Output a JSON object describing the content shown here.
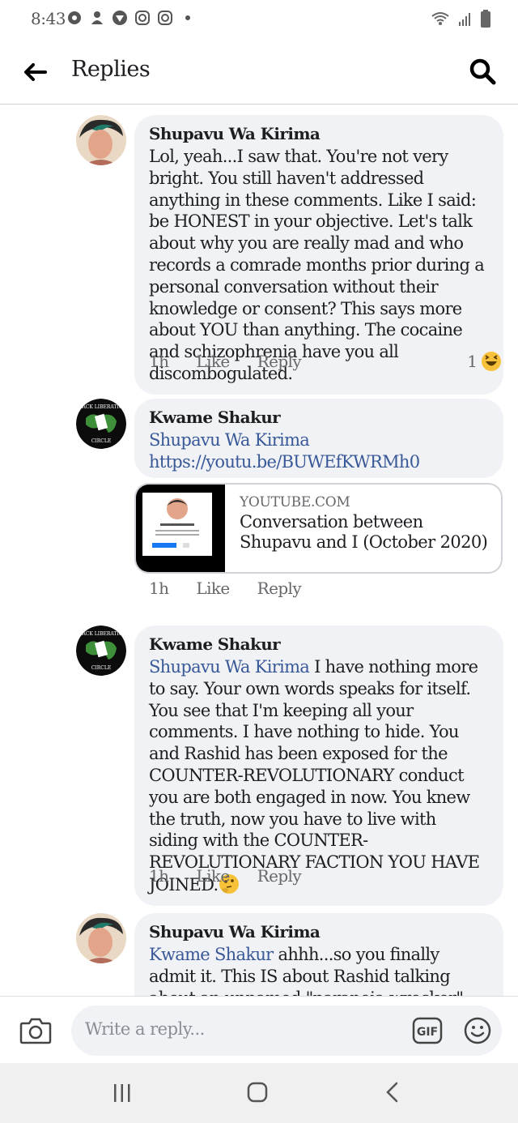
{
  "status_bar": {
    "time": "8:43"
  },
  "header": {
    "back_icon": "arrow-left-icon",
    "title": "Replies",
    "search_icon": "search-icon"
  },
  "comments": [
    {
      "author": "Shupavu Wa Kirima",
      "text": "Lol, yeah...I saw that. You're not very bright. You still haven't addressed anything in these comments. Like I said: be HONEST in your objective. Let's talk about why you are really mad and who records a comrade months prior during a personal conversation without their knowledge or consent? This says more about YOU than anything. The cocaine and schizophrenia have you all discombogulated.",
      "time": "1h",
      "like": "Like",
      "reply": "Reply",
      "reaction_count": "1",
      "reaction_icon": "haha-emoji-icon"
    },
    {
      "author": "Kwame Shakur",
      "mention": "Shupavu Wa Kirima",
      "link": "https://youtu.be/BUWEfKWRMh0",
      "card": {
        "domain": "YOUTUBE.COM",
        "title": "Conversation between Shupavu and I (October 2020)"
      },
      "time": "1h",
      "like": "Like",
      "reply": "Reply"
    },
    {
      "author": "Kwame Shakur",
      "mention": "Shupavu Wa Kirima",
      "text": " I have nothing more to say. Your own words speaks for itself. You see that I'm keeping all your comments. I have nothing to hide. You and Rashid has been exposed for the COUNTER-REVOLUTIONARY conduct you are both engaged in now. You knew the truth, now you have to live with siding with the COUNTER-REVOLUTIONARY FACTION YOU HAVE JOINED.",
      "emoji_icon": "thinking-emoji-icon",
      "time": "1h",
      "like": "Like",
      "reply": "Reply"
    },
    {
      "author": "Shupavu Wa Kirima",
      "mention": "Kwame Shakur",
      "text": " ahhh...so you finally admit it. This IS about Rashid talking about an unnamed \"paranoia wrecker\" that has you upset and not"
    }
  ],
  "composer": {
    "placeholder": "Write a reply...",
    "camera_icon": "camera-icon",
    "gif_label": "GIF",
    "emoji_icon": "smiley-icon"
  },
  "colors": {
    "mention": "#385898",
    "bubble": "#f0f2f5",
    "muted": "#65676b"
  }
}
